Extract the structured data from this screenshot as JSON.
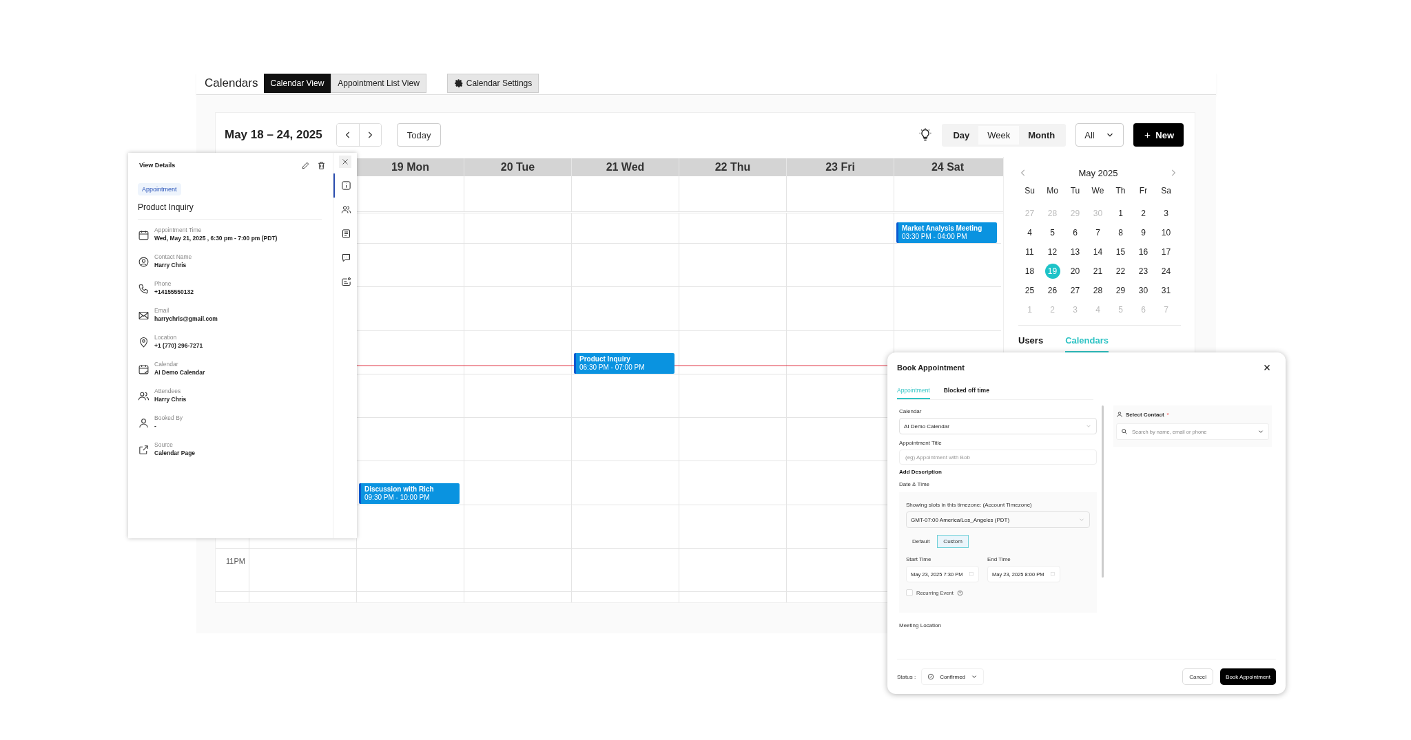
{
  "header": {
    "title": "Calendars",
    "view_tabs": [
      {
        "label": "Calendar View",
        "selected": true
      },
      {
        "label": "Appointment List View",
        "selected": false
      }
    ],
    "settings_button": "Calendar Settings"
  },
  "toolbar": {
    "date_range": "May 18 – 24, 2025",
    "today_button": "Today",
    "view_modes": [
      {
        "label": "Day",
        "selected": false
      },
      {
        "label": "Week",
        "selected": true
      },
      {
        "label": "Month",
        "selected": false
      }
    ],
    "filter": "All",
    "new_button": "New"
  },
  "week": {
    "days": [
      {
        "label": "19 Mon",
        "events": [
          {
            "title": "Discussion with Rich",
            "time": "09:30 PM - 10:00 PM"
          }
        ]
      },
      {
        "label": "20 Tue"
      },
      {
        "label": "21 Wed",
        "events": [
          {
            "title": "Product Inquiry",
            "time": "06:30 PM - 07:00 PM"
          }
        ]
      },
      {
        "label": "22 Thu"
      },
      {
        "label": "23 Fri"
      },
      {
        "label": "24 Sat",
        "events": [
          {
            "title": "Market Analysis Meeting",
            "time": "03:30 PM - 04:00 PM"
          }
        ]
      }
    ],
    "time_label": "11PM"
  },
  "mini_calendar": {
    "title": "May 2025",
    "weekdays": [
      "Su",
      "Mo",
      "Tu",
      "We",
      "Th",
      "Fr",
      "Sa"
    ],
    "days": [
      {
        "label": "27",
        "outside": true,
        "selected": false
      },
      {
        "label": "28",
        "outside": true,
        "selected": false
      },
      {
        "label": "29",
        "outside": true,
        "selected": false
      },
      {
        "label": "30",
        "outside": true,
        "selected": false
      },
      {
        "label": "1",
        "outside": false,
        "selected": false
      },
      {
        "label": "2",
        "outside": false,
        "selected": false
      },
      {
        "label": "3",
        "outside": false,
        "selected": false
      },
      {
        "label": "4",
        "outside": false,
        "selected": false
      },
      {
        "label": "5",
        "outside": false,
        "selected": false
      },
      {
        "label": "6",
        "outside": false,
        "selected": false
      },
      {
        "label": "7",
        "outside": false,
        "selected": false
      },
      {
        "label": "8",
        "outside": false,
        "selected": false
      },
      {
        "label": "9",
        "outside": false,
        "selected": false
      },
      {
        "label": "10",
        "outside": false,
        "selected": false
      },
      {
        "label": "11",
        "outside": false,
        "selected": false
      },
      {
        "label": "12",
        "outside": false,
        "selected": false
      },
      {
        "label": "13",
        "outside": false,
        "selected": false
      },
      {
        "label": "14",
        "outside": false,
        "selected": false
      },
      {
        "label": "15",
        "outside": false,
        "selected": false
      },
      {
        "label": "16",
        "outside": false,
        "selected": false
      },
      {
        "label": "17",
        "outside": false,
        "selected": false
      },
      {
        "label": "18",
        "outside": false,
        "selected": false
      },
      {
        "label": "19",
        "outside": false,
        "selected": true
      },
      {
        "label": "20",
        "outside": false,
        "selected": false
      },
      {
        "label": "21",
        "outside": false,
        "selected": false
      },
      {
        "label": "22",
        "outside": false,
        "selected": false
      },
      {
        "label": "23",
        "outside": false,
        "selected": false
      },
      {
        "label": "24",
        "outside": false,
        "selected": false
      },
      {
        "label": "25",
        "outside": false,
        "selected": false
      },
      {
        "label": "26",
        "outside": false,
        "selected": false
      },
      {
        "label": "27",
        "outside": false,
        "selected": false
      },
      {
        "label": "28",
        "outside": false,
        "selected": false
      },
      {
        "label": "29",
        "outside": false,
        "selected": false
      },
      {
        "label": "30",
        "outside": false,
        "selected": false
      },
      {
        "label": "31",
        "outside": false,
        "selected": false
      },
      {
        "label": "1",
        "outside": true,
        "selected": false
      },
      {
        "label": "2",
        "outside": true,
        "selected": false
      },
      {
        "label": "3",
        "outside": true,
        "selected": false
      },
      {
        "label": "4",
        "outside": true,
        "selected": false
      },
      {
        "label": "5",
        "outside": true,
        "selected": false
      },
      {
        "label": "6",
        "outside": true,
        "selected": false
      },
      {
        "label": "7",
        "outside": true,
        "selected": false
      }
    ],
    "tabs": [
      {
        "label": "Users",
        "selected": false
      },
      {
        "label": "Calendars",
        "selected": true
      }
    ]
  },
  "details_panel": {
    "title": "View Details",
    "tag": "Appointment",
    "heading": "Product Inquiry",
    "fields": [
      {
        "kind": "time",
        "label": "Appointment Time",
        "value": "Wed, May 21, 2025 , 6:30 pm - 7:00 pm (PDT)"
      },
      {
        "kind": "contact",
        "label": "Contact Name",
        "value": "Harry Chris"
      },
      {
        "kind": "phone",
        "label": "Phone",
        "value": "+14155550132"
      },
      {
        "kind": "email",
        "label": "Email",
        "value": "harrychris@gmail.com"
      },
      {
        "kind": "location",
        "label": "Location",
        "value": "+1 (770) 296-7271"
      },
      {
        "kind": "calendar",
        "label": "Calendar",
        "value": "AI Demo Calendar"
      },
      {
        "kind": "attendees",
        "label": "Attendees",
        "value": "Harry Chris"
      },
      {
        "kind": "booked",
        "label": "Booked By",
        "value": "-"
      },
      {
        "kind": "source",
        "label": "Source",
        "value": "Calendar Page"
      }
    ],
    "rail": [
      {
        "kind": "info",
        "selected": true
      },
      {
        "kind": "people",
        "selected": false
      },
      {
        "kind": "note",
        "selected": false
      },
      {
        "kind": "chat",
        "selected": false
      },
      {
        "kind": "card",
        "selected": false
      }
    ]
  },
  "book_dialog": {
    "title": "Book Appointment",
    "tabs": [
      {
        "label": "Appointment",
        "selected": true
      },
      {
        "label": "Blocked off time",
        "selected": false
      }
    ],
    "calendar_label": "Calendar",
    "calendar_value": "AI Demo Calendar",
    "title_label": "Appointment Title",
    "title_placeholder": "(eg) Appointment with Bob",
    "add_description": "Add Description",
    "date_time_label": "Date & Time",
    "timezone_label": "Showing slots in this timezone: (Account Timezone)",
    "timezone_value": "GMT-07:00 America/Los_Angeles (PDT)",
    "slot_modes": [
      {
        "label": "Default",
        "selected": false
      },
      {
        "label": "Custom",
        "selected": true
      }
    ],
    "start_label": "Start Time",
    "start_value": "May 23, 2025 7:30 PM",
    "end_label": "End Time",
    "end_value": "May 23, 2025 8:00 PM",
    "recurring": {
      "label": "Recurring Event",
      "checked": false
    },
    "meeting_location_label": "Meeting Location",
    "contact_label": "Select Contact",
    "required_mark": "*",
    "contact_placeholder": "Search by name, email or phone",
    "status_label": "Status :",
    "status_value": "Confirmed",
    "cancel_button": "Cancel",
    "book_button": "Book Appointment"
  }
}
